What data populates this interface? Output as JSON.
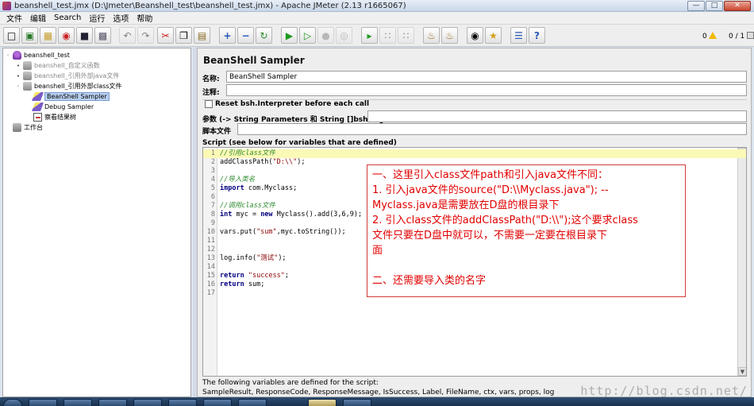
{
  "window": {
    "title": "beanshell_test.jmx (D:\\Jmeter\\Beanshell_test\\beanshell_test.jmx) - Apache JMeter (2.13 r1665067)",
    "buttons": [
      "—",
      "□",
      "✕"
    ]
  },
  "menu": [
    "文件",
    "编辑",
    "Search",
    "运行",
    "选项",
    "帮助"
  ],
  "toolbar": {
    "icons": [
      "new-icon",
      "templates-icon",
      "open-icon",
      "close-icon",
      "save-icon",
      "save-as-icon",
      "undo-icon",
      "redo-icon",
      "cut-icon",
      "copy-icon",
      "paste-icon",
      "expand-icon",
      "collapse-icon",
      "toggle-icon",
      "start-icon",
      "start-no-pause-icon",
      "stop-icon",
      "shutdown-icon",
      "remote-start-icon",
      "remote-stop-icon",
      "remote-shutdown-icon",
      "clear-icon",
      "clear-all-icon",
      "search-icon",
      "reset-search-icon",
      "function-helper-icon",
      "help-icon"
    ],
    "warnings": "0",
    "threads": "0 / 1"
  },
  "tree": [
    {
      "label": "beanshell_test",
      "icon": "test-plan-icon",
      "level": 0,
      "toggle": "minus",
      "dim": false
    },
    {
      "label": "beanshell_自定义函数",
      "icon": "thread-group-icon",
      "level": 1,
      "toggle": "plus",
      "dim": true
    },
    {
      "label": "beanshell_引用外部java文件",
      "icon": "thread-group-icon",
      "level": 1,
      "toggle": "plus",
      "dim": true
    },
    {
      "label": "beanshell_引用外部class文件",
      "icon": "thread-group-icon",
      "level": 1,
      "toggle": "minus",
      "dim": false
    },
    {
      "label": "BeanShell Sampler",
      "icon": "sampler-icon",
      "level": 2,
      "toggle": "",
      "dim": false,
      "selected": true
    },
    {
      "label": "Debug Sampler",
      "icon": "sampler-icon",
      "level": 2,
      "toggle": "",
      "dim": false
    },
    {
      "label": "察看结果树",
      "icon": "listener-icon",
      "level": 2,
      "toggle": "",
      "dim": false
    },
    {
      "label": "工作台",
      "icon": "workbench-icon",
      "level": 0,
      "toggle": "",
      "dim": false
    }
  ],
  "panel": {
    "title": "BeanShell Sampler",
    "name_label": "名称:",
    "name_value": "BeanShell Sampler",
    "comment_label": "注释:",
    "comment_value": "",
    "reset_label": "Reset bsh.Interpreter before each call",
    "params_label": "参数 (-> String Parameters 和 String []bsh.args)",
    "params_value": "",
    "script_file_label": "脚本文件",
    "script_file_value": "",
    "script_label": "Script (see below for variables that are defined)",
    "footer_line1": "The following variables are defined for the script:",
    "footer_line2": "SampleResult, ResponseCode, ResponseMessage, IsSuccess, Label, FileName, ctx, vars, props, log"
  },
  "script_lines": [
    "//引用class文件",
    "addClassPath(\"D:\\\\\");",
    "",
    "//导入类名",
    "import com.Myclass;",
    "",
    "//调用class文件",
    "int myc = new Myclass().add(3,6,9);",
    "",
    "vars.put(\"sum\",myc.toString());",
    "",
    "",
    "log.info(\"测试\");",
    "",
    "return \"success\";",
    "return sum;",
    ""
  ],
  "annotation": [
    "一、这里引入class文件path和引入java文件不同：",
    "1. 引入java文件的source(\"D:\\\\Myclass.java\"); --",
    "Myclass.java是需要放在D盘的根目录下",
    "2. 引入class文件的addClassPath(\"D:\\\\\");这个要求class",
    "文件只要在D盘中就可以，不需要一定要在根目录下",
    "面",
    "",
    "二、还需要导入类的名字"
  ],
  "watermark": "http://blog.csdn.net/"
}
